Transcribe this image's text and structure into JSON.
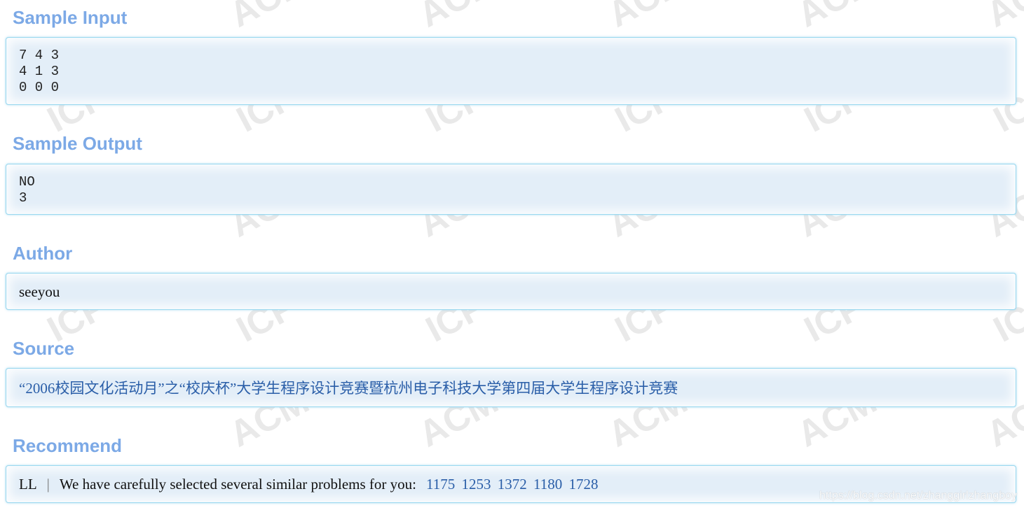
{
  "watermark": {
    "texts": [
      "ACM",
      "ICPC"
    ],
    "color": "#e9e9e9"
  },
  "sample_input": {
    "heading": "Sample Input",
    "lines": [
      "7 4 3",
      "4 1 3",
      "0 0 0"
    ]
  },
  "sample_output": {
    "heading": "Sample Output",
    "lines": [
      "NO",
      "3"
    ]
  },
  "author": {
    "heading": "Author",
    "name": "seeyou"
  },
  "source": {
    "heading": "Source",
    "text": "“2006校园文化活动月”之“校庆杯”大学生程序设计竞赛暨杭州电子科技大学第四届大学生程序设计竞赛"
  },
  "recommend": {
    "heading": "Recommend",
    "user": "LL",
    "separator": "|",
    "message": "We have carefully selected several similar problems for you:",
    "problems": [
      "1175",
      "1253",
      "1372",
      "1180",
      "1728"
    ]
  },
  "footer_watermark": "https://blog.csdn.net/zhanggirlzhangboy",
  "colors": {
    "heading": "#7ca9e6",
    "panel_bg": "#e3eef8",
    "panel_border": "#9ad8ef",
    "link": "#2a5ea8"
  }
}
